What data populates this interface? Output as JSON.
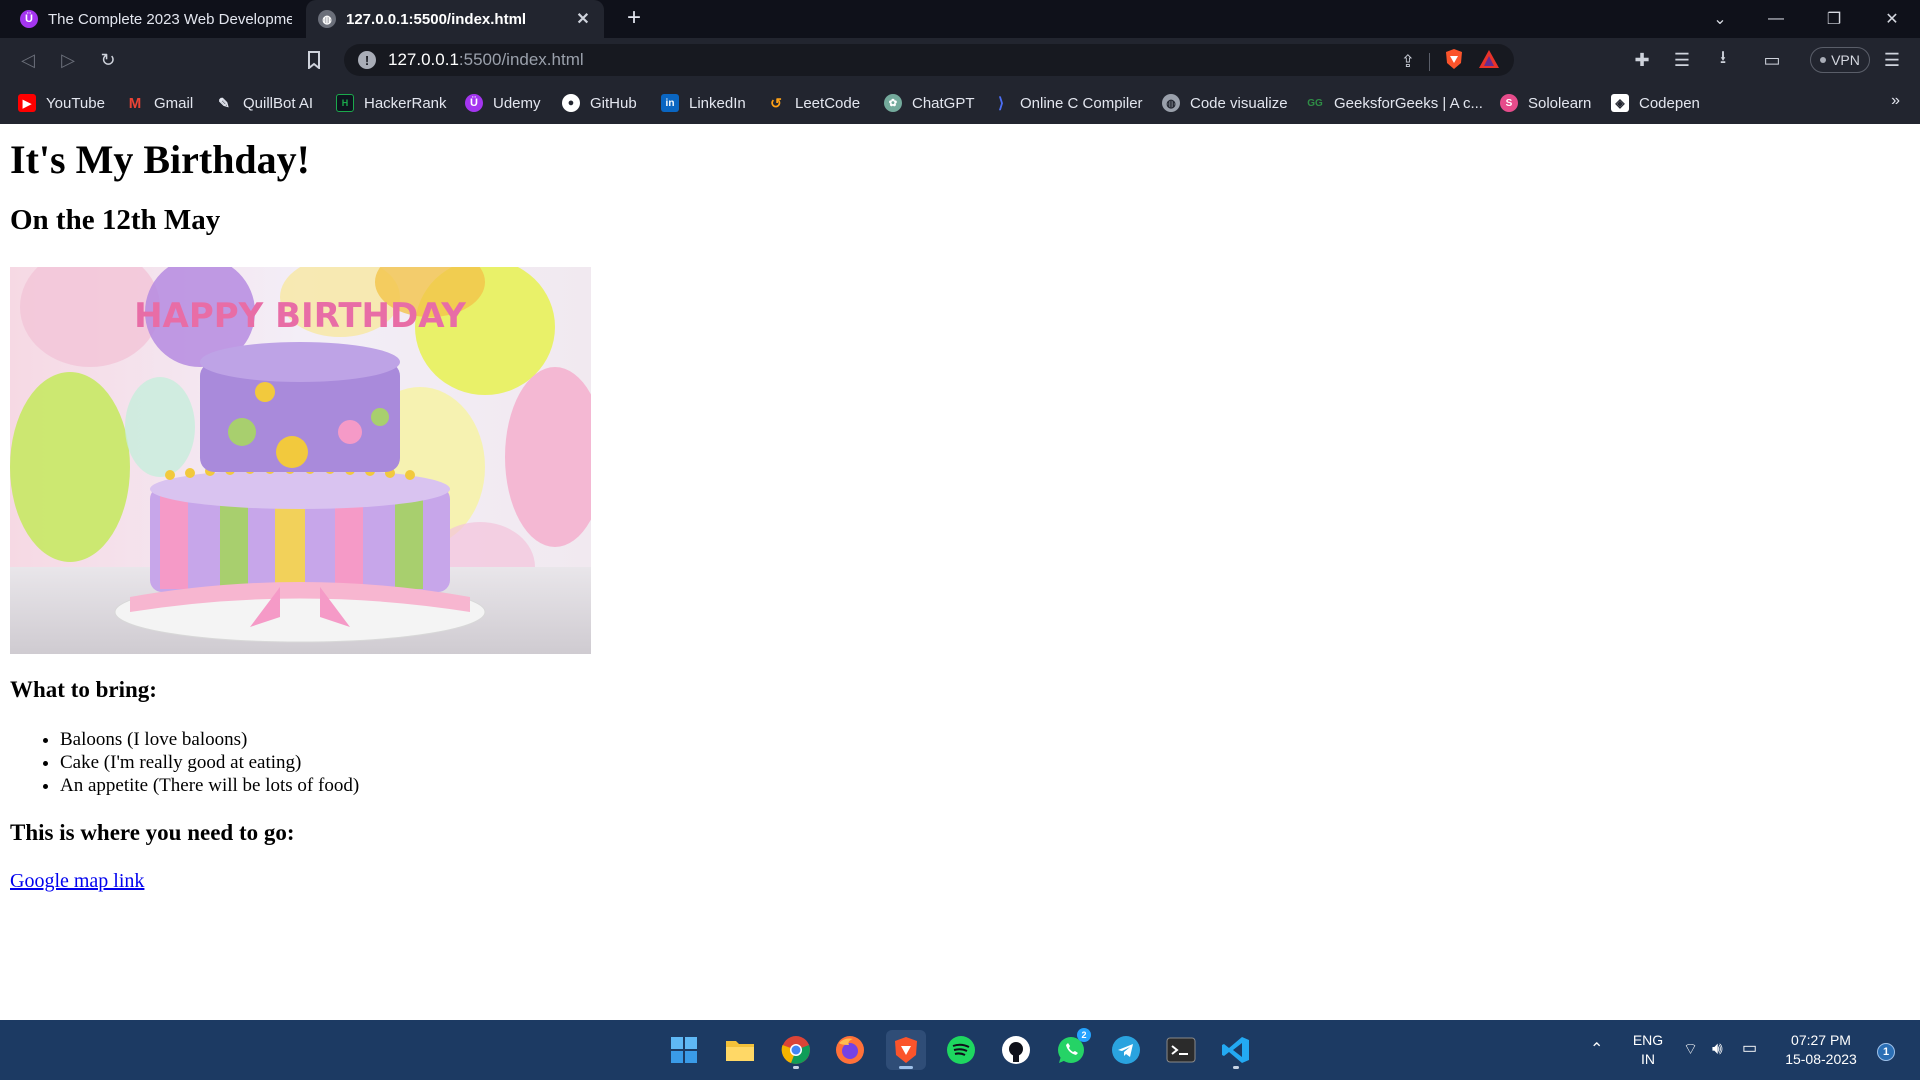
{
  "browser": {
    "tabs": [
      {
        "title": "The Complete 2023 Web Developmer",
        "favicon": "udemy-icon",
        "active": false
      },
      {
        "title": "127.0.0.1:5500/index.html",
        "favicon": "globe-icon",
        "active": true
      }
    ],
    "url_host": "127.0.0.1",
    "url_path": ":5500/index.html",
    "vpn_label": "VPN",
    "bookmarks": [
      {
        "label": "YouTube",
        "icon": "youtube-icon",
        "color": "#ff0000"
      },
      {
        "label": "Gmail",
        "icon": "gmail-icon",
        "color": "#ea4335"
      },
      {
        "label": "QuillBot AI",
        "icon": "quillbot-icon",
        "color": "#e3e6ef"
      },
      {
        "label": "HackerRank",
        "icon": "hackerrank-icon",
        "color": "#1ba94c"
      },
      {
        "label": "Udemy",
        "icon": "udemy-icon",
        "color": "#a435f0"
      },
      {
        "label": "GitHub",
        "icon": "github-icon",
        "color": "#ffffff"
      },
      {
        "label": "LinkedIn",
        "icon": "linkedin-icon",
        "color": "#0a66c2"
      },
      {
        "label": "LeetCode",
        "icon": "leetcode-icon",
        "color": "#ffa116"
      },
      {
        "label": "ChatGPT",
        "icon": "chatgpt-icon",
        "color": "#74aa9c"
      },
      {
        "label": "Online C Compiler",
        "icon": "compiler-icon",
        "color": "#4c6ef5"
      },
      {
        "label": "Code visualize",
        "icon": "globe-icon",
        "color": "#9aa0ab"
      },
      {
        "label": "GeeksforGeeks | A c...",
        "icon": "geeksforgeeks-icon",
        "color": "#2f8d46"
      },
      {
        "label": "Sololearn",
        "icon": "sololearn-icon",
        "color": "#e64c8b"
      },
      {
        "label": "Codepen",
        "icon": "codepen-icon",
        "color": "#ffffff"
      }
    ]
  },
  "page": {
    "heading": "It's My Birthday!",
    "subheading": "On the 12th May",
    "image_text": "HAPPY BIRTHDAY",
    "bring_title": "What to bring:",
    "bring_items": [
      "Baloons (I love baloons)",
      "Cake (I'm really good at eating)",
      "An appetite (There will be lots of food)"
    ],
    "where_title": "This is where you need to go:",
    "map_link": "Google map link"
  },
  "taskbar": {
    "apps": [
      "windows-start-icon",
      "file-explorer-icon",
      "chrome-icon",
      "firefox-icon",
      "brave-icon",
      "spotify-icon",
      "github-desktop-icon",
      "whatsapp-icon",
      "telegram-icon",
      "terminal-icon",
      "vscode-icon"
    ],
    "whatsapp_badge": "2",
    "lang_top": "ENG",
    "lang_bottom": "IN",
    "time": "07:27 PM",
    "date": "15-08-2023",
    "notification_count": "1"
  }
}
